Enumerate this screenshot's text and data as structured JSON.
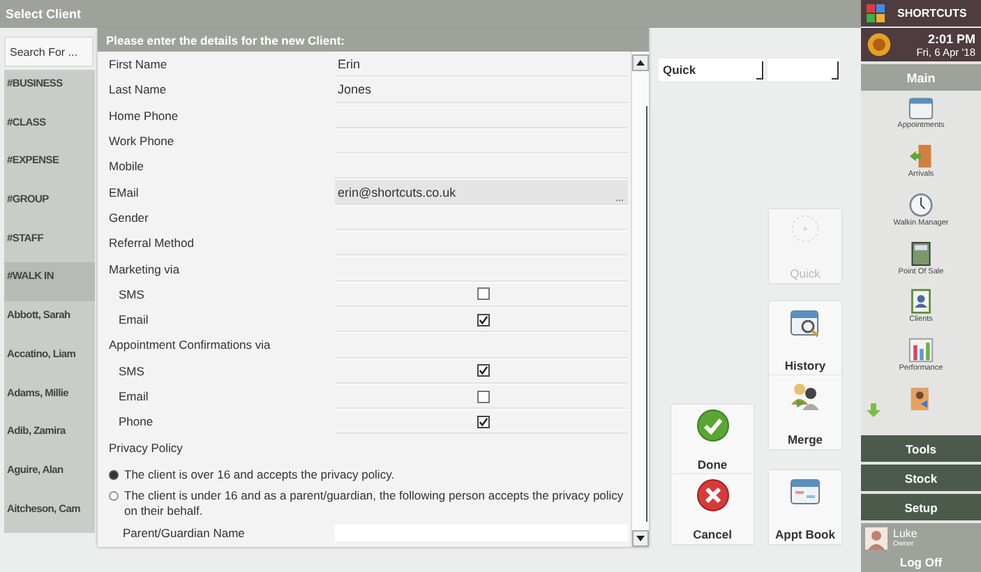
{
  "title": "Select Client",
  "search": {
    "placeholder": "Search For ..."
  },
  "clients": [
    {
      "name": "#BUSINESS",
      "selected": false
    },
    {
      "name": "#CLASS",
      "selected": false
    },
    {
      "name": "#EXPENSE",
      "selected": false
    },
    {
      "name": "#GROUP",
      "selected": false
    },
    {
      "name": "#STAFF",
      "selected": false
    },
    {
      "name": "#WALK IN",
      "selected": true
    },
    {
      "name": "Abbott, Sarah",
      "selected": false
    },
    {
      "name": "Accatino, Liam",
      "selected": false
    },
    {
      "name": "Adams, Millie",
      "selected": false
    },
    {
      "name": "Adib, Zamira",
      "selected": false
    },
    {
      "name": "Aguire, Alan",
      "selected": false
    },
    {
      "name": "Aitcheson, Cam",
      "selected": false
    }
  ],
  "dialog": {
    "title": "Please enter the details for the new Client:",
    "rows": [
      {
        "kind": "field",
        "label": "First Name",
        "value": "Erin"
      },
      {
        "kind": "field",
        "label": "Last Name",
        "value": "Jones"
      },
      {
        "kind": "field",
        "label": "Home Phone"
      },
      {
        "kind": "field",
        "label": "Work Phone"
      },
      {
        "kind": "field",
        "label": "Mobile"
      },
      {
        "kind": "lookup",
        "label": "EMail",
        "value": "erin@shortcuts.co.uk",
        "button": "..."
      },
      {
        "kind": "field",
        "label": "Gender"
      },
      {
        "kind": "field",
        "label": "Referral Method"
      },
      {
        "kind": "heading",
        "label": "Marketing via"
      },
      {
        "kind": "check",
        "label": "SMS",
        "checked": false
      },
      {
        "kind": "check",
        "label": "Email",
        "checked": true
      },
      {
        "kind": "heading",
        "label": "Appointment Confirmations via"
      },
      {
        "kind": "check",
        "label": "SMS",
        "checked": true
      },
      {
        "kind": "check",
        "label": "Email",
        "checked": false
      },
      {
        "kind": "check",
        "label": "Phone",
        "checked": true
      }
    ],
    "privacy": {
      "title": "Privacy Policy",
      "options": [
        {
          "text": "The client is over 16 and accepts the privacy policy.",
          "selected": true
        },
        {
          "text": "The client is under 16 and as a parent/guardian, the following person accepts the privacy policy on their behalf.",
          "selected": false
        }
      ],
      "guardian_label": "Parent/Guardian Name"
    }
  },
  "dropdown": {
    "value": "Quick"
  },
  "actions": [
    {
      "label": "Quick",
      "disabled": true
    },
    {
      "label": "History",
      "disabled": false
    },
    {
      "label": "Merge",
      "disabled": false
    },
    {
      "label": "Appt Book",
      "disabled": false
    }
  ],
  "confirm": [
    {
      "label": "Done",
      "kind": "done"
    },
    {
      "label": "Cancel",
      "kind": "cancel"
    }
  ],
  "sidebar": {
    "brand": "SHORTCUTS",
    "time": "2:01 PM",
    "date": "Fri, 6 Apr '18",
    "section": "Main",
    "apps": [
      {
        "label": "Appointments"
      },
      {
        "label": "Arrivals"
      },
      {
        "label": "Walkin Manager"
      },
      {
        "label": "Point Of Sale"
      },
      {
        "label": "Clients"
      },
      {
        "label": "Performance"
      }
    ],
    "menus": [
      "Tools",
      "Stock",
      "Setup"
    ],
    "user": {
      "name": "Luke",
      "role": "Owner"
    },
    "logoff": "Log Off"
  }
}
